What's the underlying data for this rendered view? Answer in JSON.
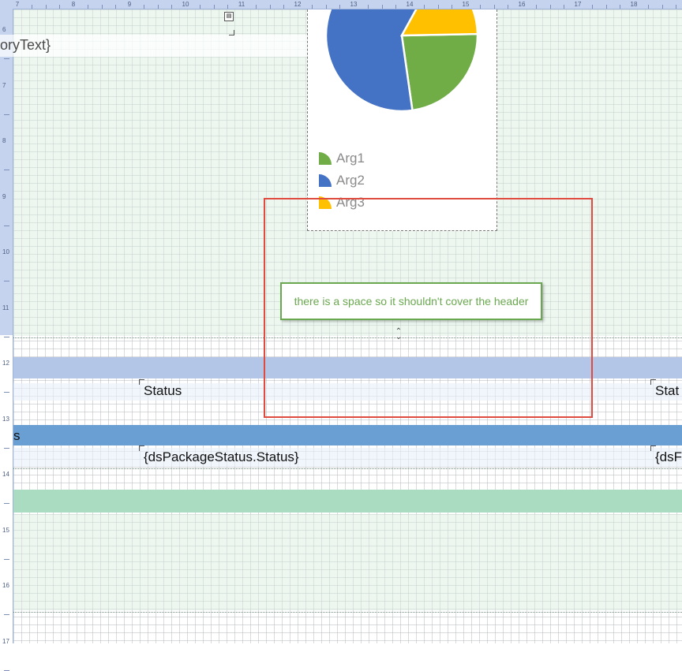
{
  "ruler": {
    "top_labels": [
      "7",
      "8",
      "9",
      "10",
      "11",
      "12",
      "13",
      "14",
      "15",
      "16",
      "17",
      "18"
    ],
    "left_labels": [
      "6",
      "7",
      "8",
      "9",
      "10",
      "11",
      "12",
      "13",
      "14",
      "15",
      "16",
      "17"
    ]
  },
  "report": {
    "category_text": "oryText}",
    "status_header_left": "Status",
    "status_header_right": "Stat",
    "group_header_text": "s",
    "status_field_left": "{dsPackageStatus.Status}",
    "status_field_right": "{dsF"
  },
  "chart_data": {
    "type": "pie",
    "categories": [
      "Arg1",
      "Arg2",
      "Arg3"
    ],
    "values": [
      18,
      47,
      13
    ],
    "colors": [
      "#70ad47",
      "#4472c4",
      "#ffc000"
    ],
    "legend": "bottom-left",
    "partial": true
  },
  "legend": {
    "items": [
      {
        "label": "Arg1",
        "color": "#70ad47"
      },
      {
        "label": "Arg2",
        "color": "#4472c4"
      },
      {
        "label": "Arg3",
        "color": "#ffc000"
      }
    ]
  },
  "annotation": {
    "note": "there is a space so it shouldn't cover the header",
    "frame_color": "#e04b3f",
    "note_color": "#6aa84f"
  },
  "colors": {
    "band_header": "#b4c6e7",
    "band_group": "#6a9fd4",
    "band_footer": "#a9dcc1"
  }
}
